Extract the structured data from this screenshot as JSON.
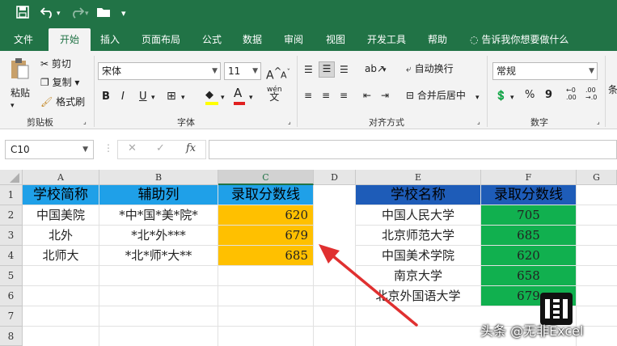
{
  "tabs": [
    "文件",
    "开始",
    "插入",
    "页面布局",
    "公式",
    "数据",
    "审阅",
    "视图",
    "开发工具",
    "帮助",
    "告诉我你想要做什么"
  ],
  "ribbon": {
    "paste": "粘贴",
    "cut": "剪切",
    "copy": "复制",
    "format_painter": "格式刷",
    "clipboard_group": "剪贴板",
    "font_name": "宋体",
    "font_size": "11",
    "bold": "B",
    "italic": "I",
    "underline": "U",
    "font_group": "字体",
    "wrap_text": "自动换行",
    "merge_center": "合并后居中",
    "align_group": "对齐方式",
    "number_format": "常规",
    "percent": "%",
    "comma": "9",
    "number_group": "数字",
    "styles_cut": "条"
  },
  "formula_bar": {
    "name_box": "C10",
    "fx": "fx",
    "cancel": "✕",
    "enter": "✓"
  },
  "sheet": {
    "columns": [
      "A",
      "B",
      "C",
      "D",
      "E",
      "F",
      "G"
    ],
    "rows": [
      "1",
      "2",
      "3",
      "4",
      "5",
      "6",
      "7",
      "8"
    ],
    "table1": {
      "headers": [
        "学校简称",
        "辅助列",
        "录取分数线"
      ],
      "rows": [
        [
          "中国美院",
          "*中*国*美*院*",
          "620"
        ],
        [
          "北外",
          "*北*外***",
          "679"
        ],
        [
          "北师大",
          "*北*师*大**",
          "685"
        ]
      ]
    },
    "table2": {
      "headers": [
        "学校名称",
        "录取分数线"
      ],
      "rows": [
        [
          "中国人民大学",
          "705"
        ],
        [
          "北京师范大学",
          "685"
        ],
        [
          "中国美术学院",
          "620"
        ],
        [
          "南京大学",
          "658"
        ],
        [
          "北京外国语大学",
          "679"
        ]
      ]
    }
  },
  "watermark": {
    "text": "头条 @无非Excel"
  },
  "colors": {
    "excel_green": "#217346",
    "header_blue": "#1fa0e8",
    "header_navy": "#1e5cb8",
    "value_orange": "#ffc000",
    "value_green": "#11b04f",
    "arrow_red": "#e03030"
  }
}
